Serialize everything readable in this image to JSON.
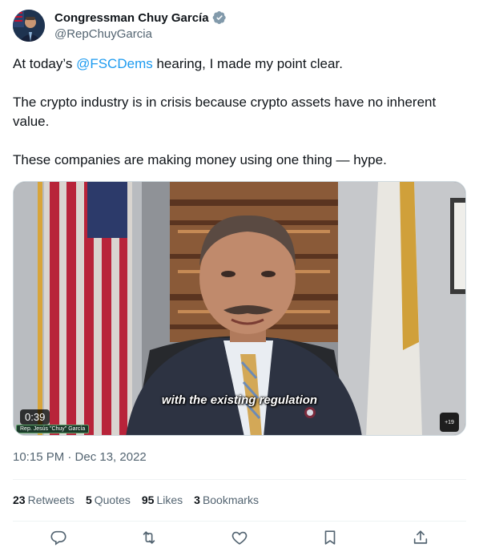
{
  "author": {
    "name": "Congressman Chuy García",
    "handle": "@RepChuyGarcia",
    "verified_color": "#829aab"
  },
  "tweet": {
    "line1_before": "At today’s ",
    "mention": "@FSCDems",
    "line1_after": " hearing, I made my point clear.",
    "paragraph2": "The crypto industry is in crisis because crypto assets have no inherent value.",
    "paragraph3": "These companies are making money using one thing — hype."
  },
  "video": {
    "caption": "with the existing regulation",
    "duration": "0:39",
    "name_strip": "Rep. Jesús \"Chuy\" García",
    "volume_label": "+19"
  },
  "timestamp": "10:15 PM · Dec 13, 2022",
  "stats": [
    {
      "count": "23",
      "label": "Retweets"
    },
    {
      "count": "5",
      "label": "Quotes"
    },
    {
      "count": "95",
      "label": "Likes"
    },
    {
      "count": "3",
      "label": "Bookmarks"
    }
  ],
  "actions": [
    "reply-icon",
    "retweet-icon",
    "like-icon",
    "bookmark-icon",
    "share-icon"
  ],
  "colors": {
    "link": "#1d9bf0",
    "muted": "#536471",
    "text": "#0f1419"
  }
}
